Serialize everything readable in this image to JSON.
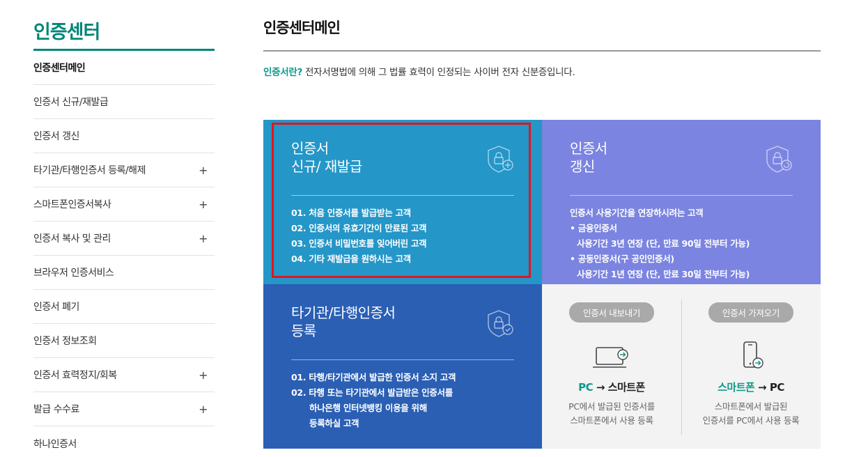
{
  "sidebar": {
    "title": "인증센터",
    "items": [
      {
        "label": "인증센터메인",
        "plus": ""
      },
      {
        "label": "인증서 신규/재발급",
        "plus": ""
      },
      {
        "label": "인증서 갱신",
        "plus": ""
      },
      {
        "label": "타기관/타행인증서 등록/해제",
        "plus": "+"
      },
      {
        "label": "스마트폰인증서복사",
        "plus": "+"
      },
      {
        "label": "인증서 복사 및 관리",
        "plus": "+"
      },
      {
        "label": "브라우저 인증서비스",
        "plus": ""
      },
      {
        "label": "인증서 폐기",
        "plus": ""
      },
      {
        "label": "인증서 정보조회",
        "plus": ""
      },
      {
        "label": "인증서 효력정지/회복",
        "plus": "+"
      },
      {
        "label": "발급 수수료",
        "plus": "+"
      },
      {
        "label": "하나인증서",
        "plus": ""
      }
    ]
  },
  "main": {
    "title": "인증센터메인",
    "intro_highlight": "인증서란?",
    "intro_text": " 전자서명법에 의해 그 법률 효력이 인정되는 사이버 전자 신분증입니다.",
    "cards": {
      "new": {
        "title": "인증서\n신규/ 재발급",
        "lines": [
          "01. 처음 인증서를 발급받는 고객",
          "02. 인증서의 유효기간이 만료된 고객",
          "03. 인증서 비밀번호를 잊어버린 고객",
          "04. 기타 재발급을 원하시는 고객"
        ]
      },
      "renew": {
        "title": "인증서\n갱신",
        "line1": "인증서 사용기간을 연장하시려는 고객",
        "line2": "• 금융인증서",
        "line3": "사용기간 3년 연장 (단, 만료 90일 전부터 가능)",
        "line4": "• 공동인증서(구 공인인증서)",
        "line5": "사용기간 1년 연장 (단, 만료 30일 전부터 가능)"
      },
      "register": {
        "title": "타기관/타행인증서\n등록",
        "line1": "01. 타행/타기관에서 발급한 인증서 소지 고객",
        "line2": "02. 타행 또는 타기관에서 발급받은 인증서를",
        "line3": "하나은행 인터넷뱅킹 이용을 위해",
        "line4": "등록하실 고객"
      },
      "copy": {
        "export_label": "인증서 내보내기",
        "export_dir_from": "PC",
        "export_dir_arrow": " → ",
        "export_dir_to": "스마트폰",
        "export_desc": "PC에서 발급된 인증서를\n스마트폰에서 사용 등록",
        "import_label": "인증서 가져오기",
        "import_dir_from": "스마트폰",
        "import_dir_arrow": " → ",
        "import_dir_to": "PC",
        "import_desc": "스마트폰에서 발급된\n인증서를 PC에서 사용 등록"
      }
    }
  },
  "colors": {
    "brand": "#008577",
    "card_new": "#2596c8",
    "card_renew": "#7b84e0",
    "card_register": "#2a5fb4",
    "highlight_border": "#e3141e"
  }
}
